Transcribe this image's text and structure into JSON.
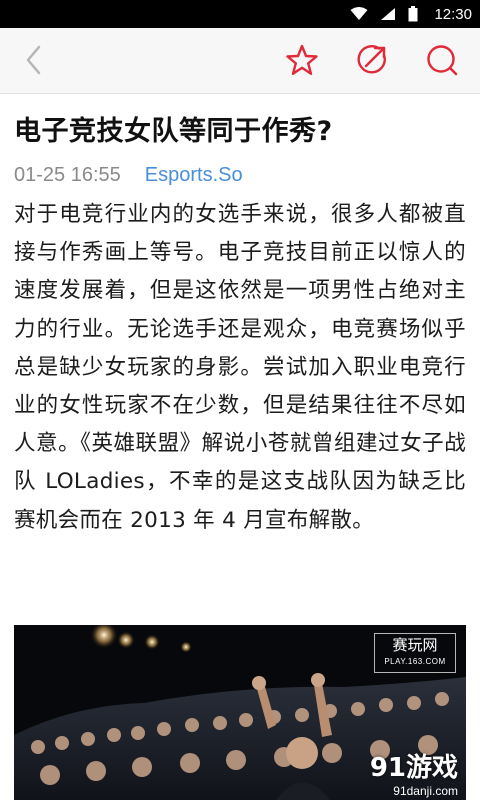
{
  "status_bar": {
    "time": "12:30",
    "icons": [
      "wifi-icon",
      "signal-icon",
      "battery-icon"
    ]
  },
  "toolbar": {
    "icons": [
      "back-icon",
      "star-icon",
      "share-icon",
      "comment-icon"
    ],
    "accent_color": "#e02a3a"
  },
  "article": {
    "title": "电子竞技女队等同于作秀?",
    "date": "01-25 16:55",
    "source": "Esports.So",
    "body": "对于电竞行业内的女选手来说，很多人都被直接与作秀画上等号。电子竞技目前正以惊人的速度发展着，但是这依然是一项男性占绝对主力的行业。无论选手还是观众，电竞赛场似乎总是缺少女玩家的身影。尝试加入职业电竞行业的女性玩家不在少数，但是结果往往不尽如人意。《英雄联盟》解说小苍就曾组建过女子战队 LOLadies，不幸的是这支战队因为缺乏比赛机会而在 2013 年 4 月宣布解散。"
  },
  "image": {
    "watermark_top_line1": "赛玩网",
    "watermark_top_line2": "PLAY.163.COM",
    "watermark_bottom_line1": "91游戏",
    "watermark_bottom_line2": "91danji.com"
  }
}
